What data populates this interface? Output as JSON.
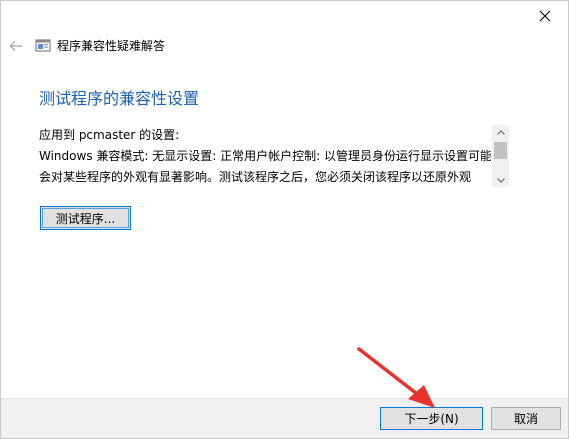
{
  "window": {
    "title": "程序兼容性疑难解答"
  },
  "page": {
    "heading": "测试程序的兼容性设置"
  },
  "settings": {
    "lines": [
      "应用到 pcmaster 的设置:",
      "Windows 兼容模式: 无显示设置: 正常用户帐户控制: 以管理员身份运行显示设置可能",
      "会对某些程序的外观有显著影响。测试该程序之后，您必须关闭该程序以还原外观"
    ]
  },
  "buttons": {
    "test": "测试程序...",
    "next": "下一步(N)",
    "cancel": "取消"
  },
  "colors": {
    "heading": "#1d5fb2",
    "focus_border": "#0078d7",
    "footer_bg": "#f0f0f0",
    "annotation_arrow": "#e8322e"
  },
  "icons": {
    "back": "back-arrow-icon",
    "close": "close-icon",
    "app": "troubleshooter-icon",
    "scroll_up": "chevron-up-icon",
    "scroll_down": "chevron-down-icon"
  }
}
